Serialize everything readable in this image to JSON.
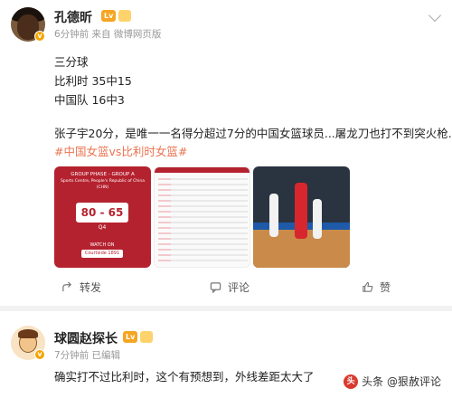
{
  "post1": {
    "author": "孔德昕",
    "rank_badge": "Lv",
    "meta": "6分钟前 来自 微博网页版",
    "lines": [
      "三分球",
      "比利时 35中15",
      "中国队 16中3"
    ],
    "body": "张子宇20分，是唯一一名得分超过7分的中国女篮球员...屠龙刀也打不到突火枪..",
    "hashtag": "#中国女篮vs比利时女篮#",
    "images": {
      "scorecard": {
        "header": "GROUP PHASE - GROUP A",
        "subheader": "Sports Centre, People's Republic of China (CHN)",
        "score": "80 - 65",
        "period": "Q4",
        "watch": "WATCH ON",
        "button": "Courtside 1891"
      }
    },
    "actions": {
      "forward": "转发",
      "comment": "评论",
      "like": "赞"
    }
  },
  "post2": {
    "author": "球圆赵探长",
    "meta": "7分钟前 已编辑",
    "body": "确实打不过比利时，这个有预想到，外线差距太大了"
  },
  "watermark": {
    "icon": "头",
    "text": "头条 @狠赦评论"
  },
  "colors": {
    "accent": "#eb7350",
    "gold": "#f5a623",
    "red": "#b5222f"
  }
}
